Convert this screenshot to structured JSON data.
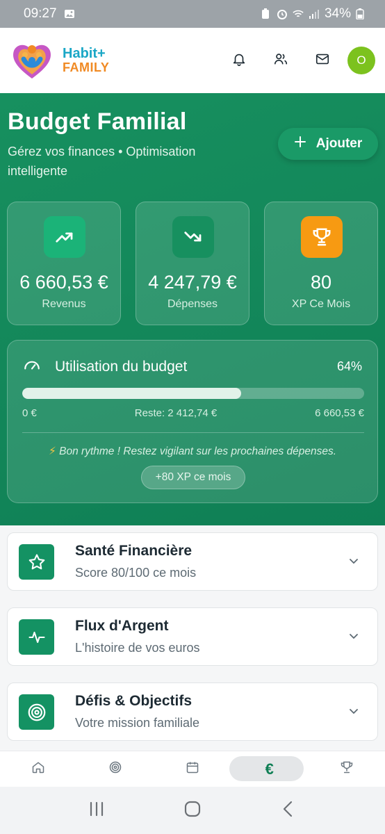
{
  "status_bar": {
    "time": "09:27",
    "battery": "34%"
  },
  "header": {
    "brand_line1": "Habit+",
    "brand_line2": "FAMILY",
    "avatar_initial": "O"
  },
  "hero": {
    "title": "Budget Familial",
    "subtitle": "Gérez vos finances • Optimisation intelligente",
    "add_label": "Ajouter"
  },
  "stats": [
    {
      "value": "6 660,53 €",
      "label": "Revenus",
      "color": "#1bb378",
      "icon": "trending-up-icon"
    },
    {
      "value": "4 247,79 €",
      "label": "Dépenses",
      "color": "#17905f",
      "icon": "trending-down-icon"
    },
    {
      "value": "80",
      "label": "XP Ce Mois",
      "color": "#f79a12",
      "icon": "trophy-icon"
    }
  ],
  "budget": {
    "title": "Utilisation du budget",
    "percent_label": "64%",
    "fill_percent": 64,
    "min_label": "0 €",
    "remaining_label": "Reste: 2 412,74 €",
    "max_label": "6 660,53 €",
    "tip": "Bon rythme ! Restez vigilant sur les prochaines dépenses.",
    "xp_label": "+80 XP ce mois"
  },
  "cards": [
    {
      "title": "Santé Financière",
      "subtitle": "Score 80/100 ce mois",
      "icon": "star-icon"
    },
    {
      "title": "Flux d'Argent",
      "subtitle": "L'histoire de vos euros",
      "icon": "activity-icon"
    },
    {
      "title": "Défis & Objectifs",
      "subtitle": "Votre mission familiale",
      "icon": "target-icon"
    }
  ],
  "bottom_nav": {
    "items": [
      "home-icon",
      "target-icon",
      "calendar-icon",
      "euro-icon",
      "trophy-icon"
    ],
    "active_index": 3,
    "euro_glyph": "€"
  }
}
